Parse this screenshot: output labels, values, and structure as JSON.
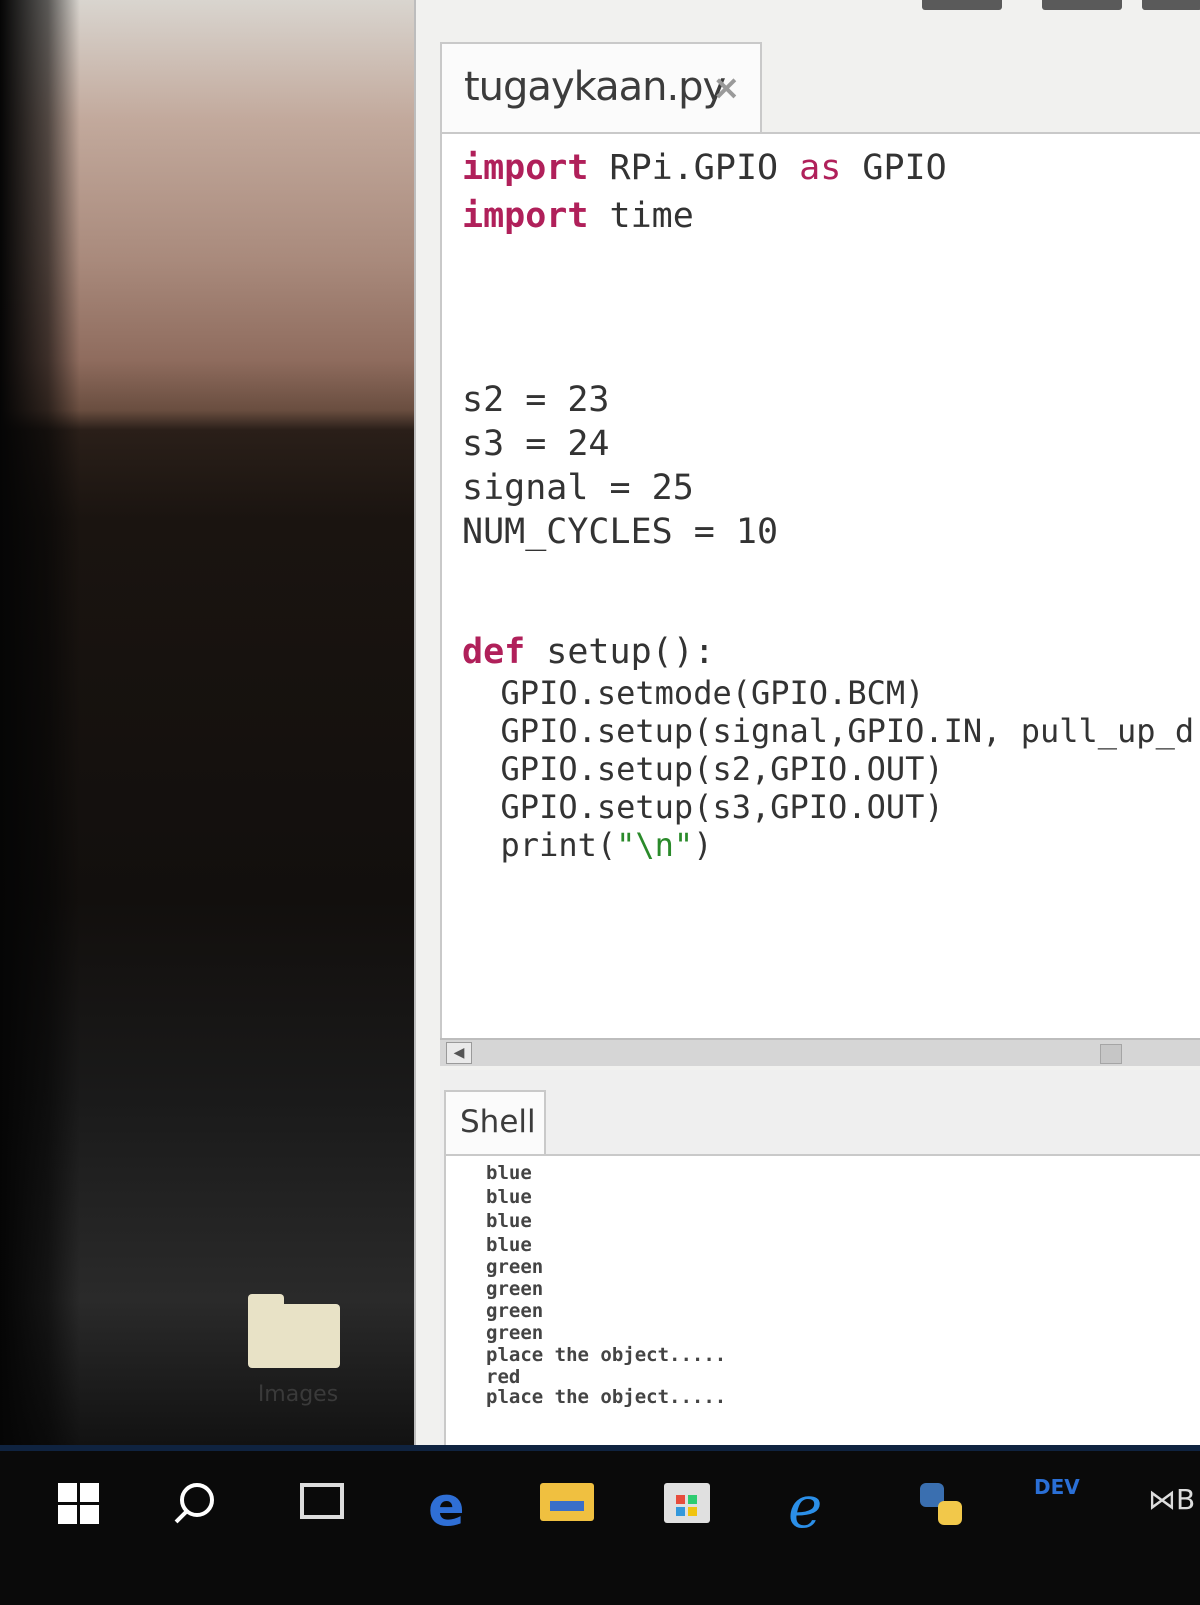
{
  "desktop": {
    "folder_label": "Images"
  },
  "editor": {
    "tab_title": "tugaykaan.py",
    "tab_close": "×",
    "lines": {
      "l1_kw": "import",
      "l1_rest": " RPi.GPIO ",
      "l1_as": "as",
      "l1_end": " GPIO",
      "l2_kw": "import",
      "l2_rest": " time",
      "l3": "s2 = 23",
      "l4": "s3 = 24",
      "l5": "signal = 25",
      "l6": "NUM_CYCLES = 10",
      "l7_kw": "def",
      "l7_rest": " setup():",
      "l8": "  GPIO.setmode(GPIO.BCM)",
      "l9": "  GPIO.setup(signal,GPIO.IN, pull_up_d",
      "l10": "  GPIO.setup(s2,GPIO.OUT)",
      "l11": "  GPIO.setup(s3,GPIO.OUT)",
      "l12_fn": "  print(",
      "l12_str": "\"\\n\"",
      "l12_end": ")"
    }
  },
  "shell": {
    "tab_label": "Shell",
    "output": [
      "blue",
      "blue",
      "blue",
      "blue",
      "green",
      "green",
      "green",
      "green",
      "place the object.....",
      "red",
      "place the object....."
    ]
  },
  "taskbar": {
    "icons": [
      "windows-start-icon",
      "search-icon",
      "task-view-icon",
      "edge-icon",
      "file-explorer-icon",
      "store-icon",
      "internet-explorer-icon",
      "python-icon",
      "dev-icon",
      "visual-studio-icon"
    ],
    "dev_label": "DEV",
    "edge_glyph": "e",
    "ie_glyph": "e",
    "vs_glyph": "⋈B"
  }
}
